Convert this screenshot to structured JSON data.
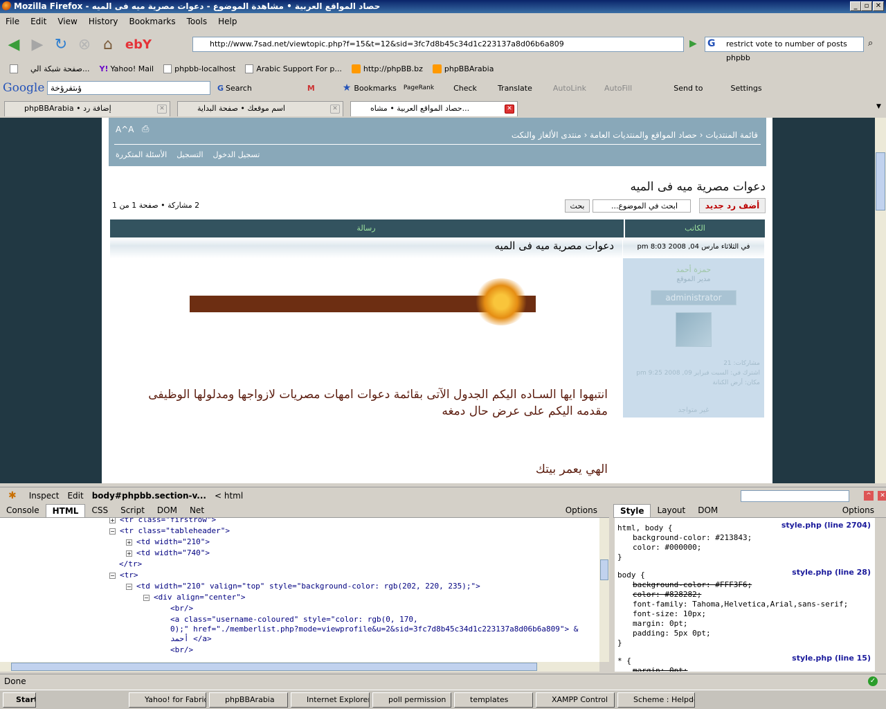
{
  "window": {
    "title": "حصاد المواقع العربية • مشاهدة الموضوع - دعوات مصرية ميه فى الميه - Mozilla Firefox"
  },
  "menu": [
    "File",
    "Edit",
    "View",
    "History",
    "Bookmarks",
    "Tools",
    "Help"
  ],
  "nav": {
    "url": "http://www.7sad.net/viewtopic.php?f=15&t=12&sid=3fc7d8b45c34d1c223137a8d06b6a809",
    "search": "restrict vote to number of posts phpbb"
  },
  "bookmarks": [
    "صفحة شبكة الي...",
    "Yahoo! Mail",
    "phpbb-localhost",
    "Arabic Support For p...",
    "http://phpBB.bz",
    "phpBBArabia"
  ],
  "googlebar": {
    "logo": "Google",
    "query": "ؤىتفرؤخة",
    "search": "Search",
    "bookmarks": "Bookmarks",
    "pagerank": "PageRank",
    "check": "Check",
    "translate": "Translate",
    "autolink": "AutoLink",
    "autofill": "AutoFill",
    "sendto": "Send to",
    "settings": "Settings"
  },
  "tabs": [
    {
      "label": "phpBBArabia • إضافة رد"
    },
    {
      "label": "اسم موقعك • صفحة البداية"
    },
    {
      "label": "حصاد المواقع العربية • مشاه..."
    }
  ],
  "forum": {
    "crumb": "قائمة المنتديات ‹ حصاد المواقع والمنتديات العامة ‹ منتدى الألغاز والنكت",
    "links": {
      "faq": "الأسئلة المتكررة",
      "register": "التسجيل",
      "login": "تسجيل الدخول"
    },
    "topic_title": "دعوات مصرية ميه فى الميه",
    "reply": "أضف رد جديد",
    "search_placeholder": "ابحث في الموضوع...",
    "search_btn": "بحث",
    "page_stat": "2 مشاركة • صفحة 1 من 1",
    "th_author": "الكاتب",
    "th_message": "رسالة",
    "post_date": "في الثلاثاء مارس 04, 2008 8:03 pm",
    "post_title": "دعوات مصرية ميه فى الميه",
    "author": {
      "name": "حمزة أحمد",
      "rank": "مدير الموقع",
      "rank_img": "administrator",
      "posts": "مشاركات: 21",
      "joined": "اشترك في: السبت فبراير 09, 2008 9:25 pm",
      "location": "مكان: أرض الكنانة",
      "online": "غير متواجد"
    },
    "body1": "انتبهوا ايها السـاده اليكم الجدول الآتى بقائمة دعوات امهات مصريات لازواجها ومدلولها الوظيفى مقدمه اليكم على عرض حال دمغه",
    "body2": "الهي يعمر بيتك"
  },
  "firebug": {
    "toolbar": {
      "inspect": "Inspect",
      "edit": "Edit",
      "path": "body#phpbb.section-v...",
      "path2": "< html"
    },
    "tabs": [
      "Console",
      "HTML",
      "CSS",
      "Script",
      "DOM",
      "Net"
    ],
    "options": "Options",
    "side_tabs": [
      "Style",
      "Layout",
      "DOM"
    ],
    "html_lines": [
      "<tr class=\"firstrow\">",
      "<tr class=\"tableheader\">",
      "<td width=\"210\">",
      "<td width=\"740\">",
      "</tr>",
      "<tr>",
      "<td width=\"210\" valign=\"top\" style=\"background-color: rgb(202, 220, 235);\">",
      "<div align=\"center\">",
      "<br/>",
      "<a class=\"username-coloured\" style=\"color: rgb(0, 170,",
      "0);\" href=\"./memberlist.php?mode=viewprofile&u=2&sid=3fc7d8b45c34d1c223137a8d06b6a809\"> &",
      "أحمد </a>",
      "<br/>"
    ],
    "style": {
      "src1": "style.php (line 2704)",
      "src2": "style.php (line 28)",
      "src3": "style.php (line 15)",
      "r1": "html, body {",
      "r1a": "background-color: #213843;",
      "r1b": "color: #000000;",
      "r2": "body {",
      "r2a": "background-color: #FFF3F6;",
      "r2b": "color: #828282;",
      "r2c": "font-family: Tahoma,Helvetica,Arial,sans-serif;",
      "r2d": "font-size: 10px;",
      "r2e": "margin: 0pt;",
      "r2f": "padding: 5px 0pt;",
      "r3": "* {",
      "r3a": "margin: 0pt;",
      "close": "}"
    }
  },
  "status": "Done",
  "taskbar": [
    "Start",
    "Yahoo! for Fabric...",
    "phpBBArabia",
    "Internet Explorer",
    "poll permission",
    "templates",
    "XAMPP Control",
    "Scheme : Helpdesk"
  ]
}
